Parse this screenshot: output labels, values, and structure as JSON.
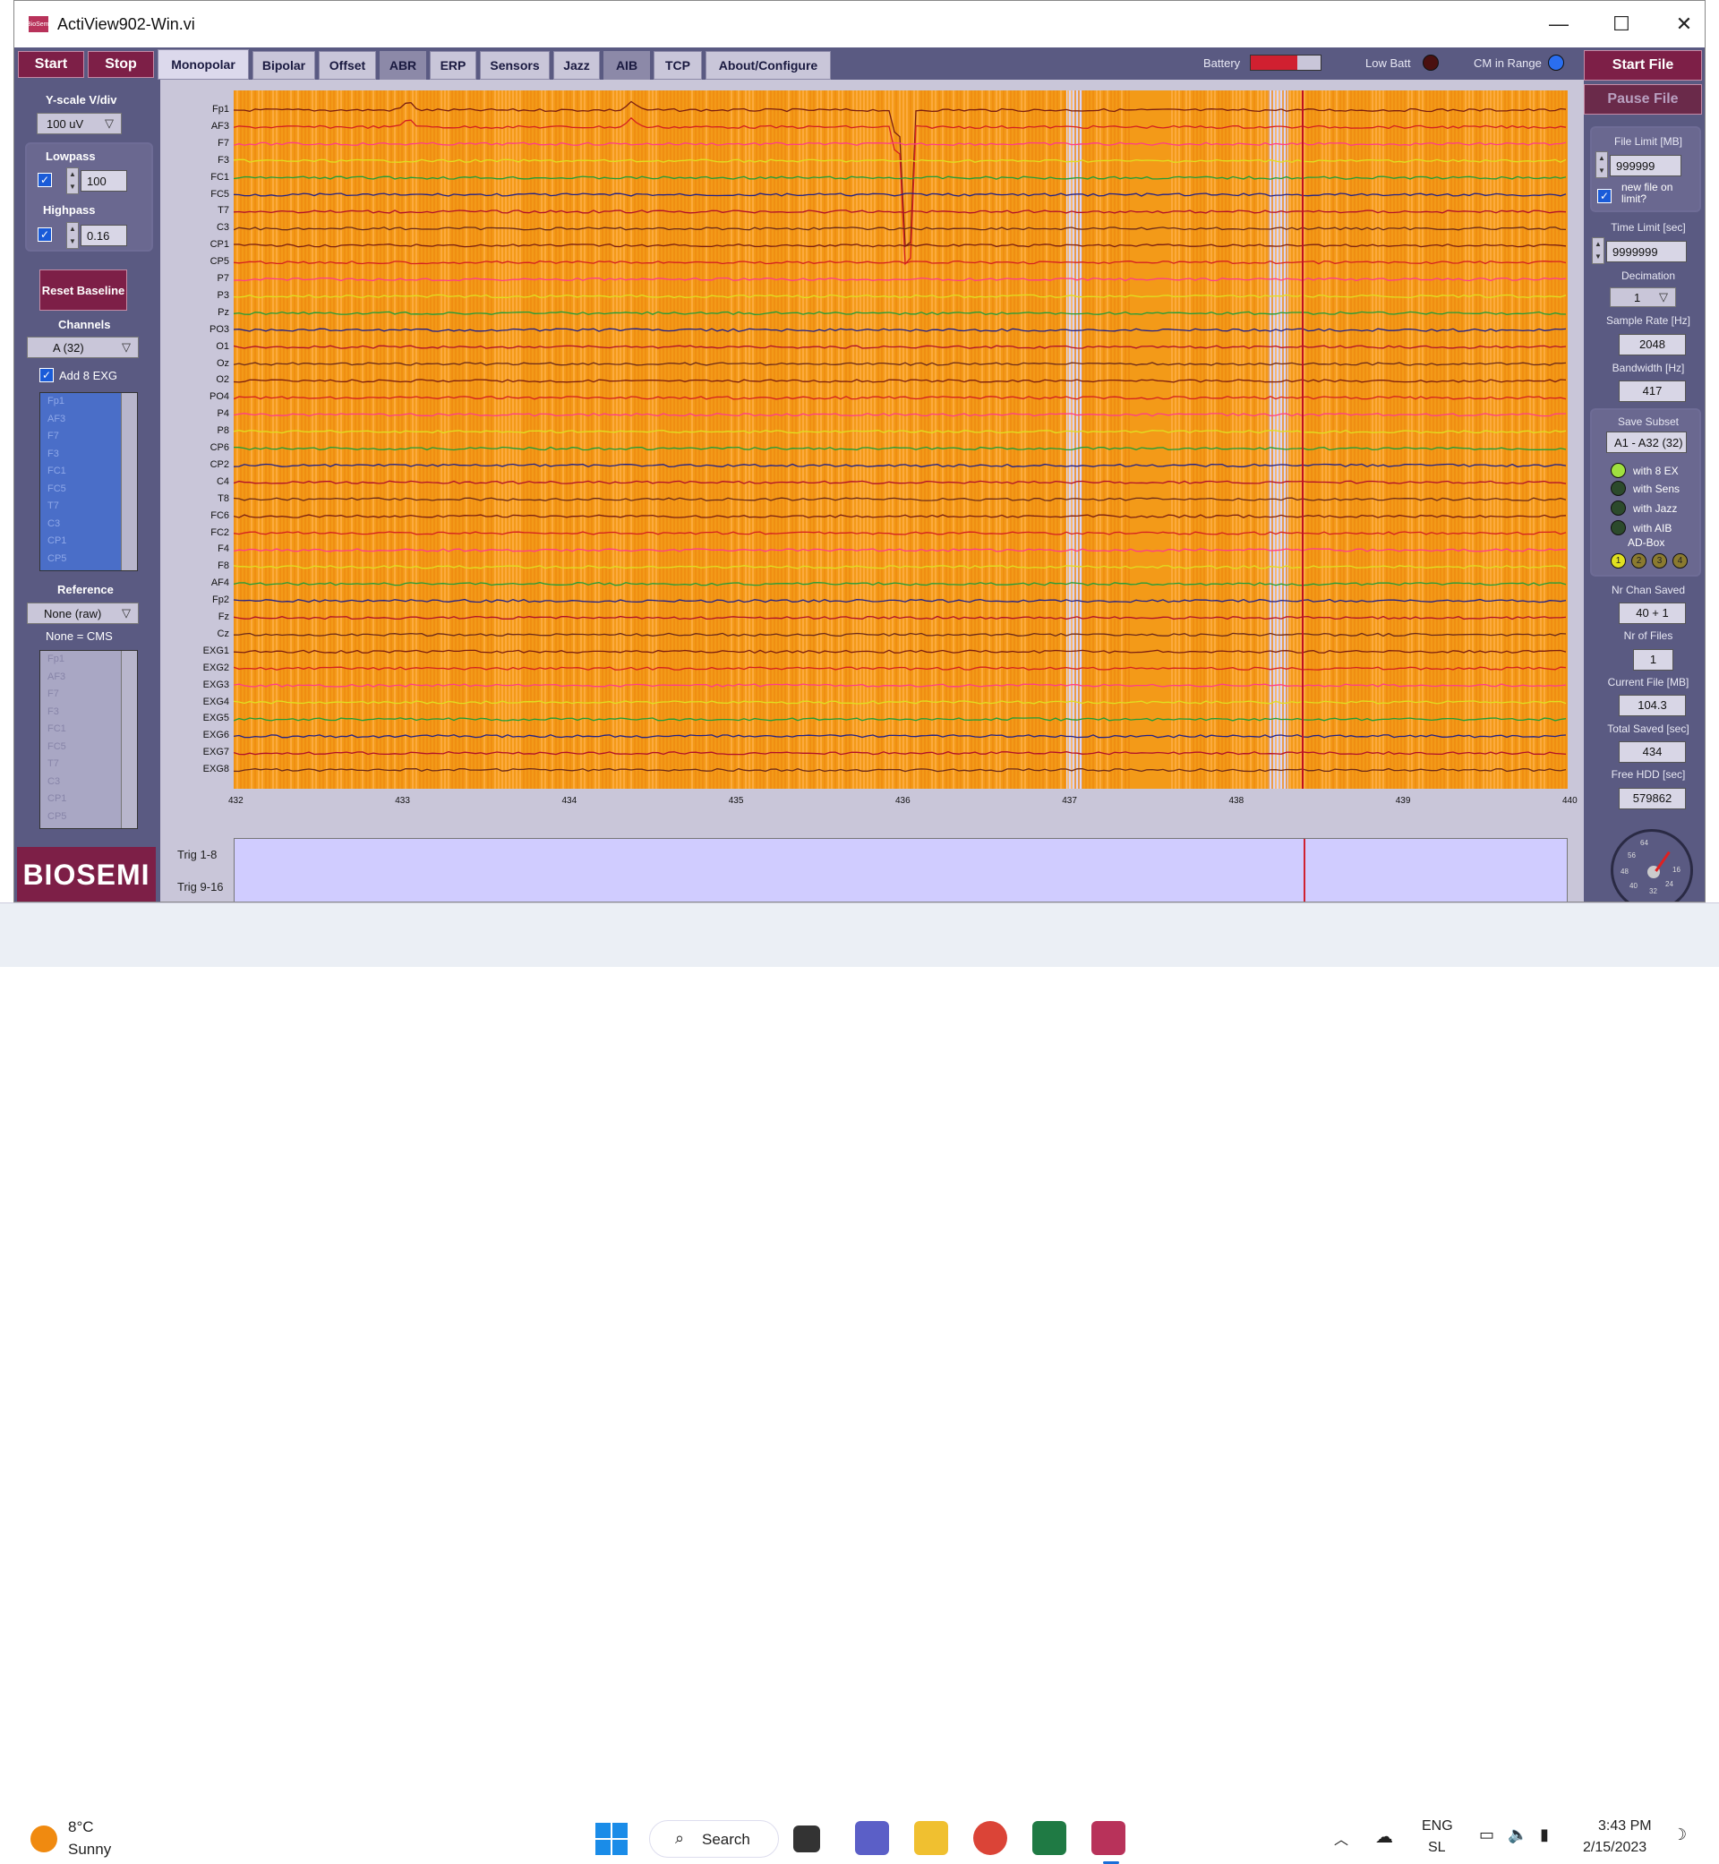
{
  "window": {
    "title": "ActiView902-Win.vi",
    "minimize": "—",
    "maximize": "☐",
    "close": "✕",
    "icon_text": "BioSemi"
  },
  "controls": {
    "start": "Start",
    "stop": "Stop",
    "start_file": "Start File",
    "pause_file": "Pause File"
  },
  "tabs": [
    {
      "label": "Monopolar",
      "active": true
    },
    {
      "label": "Bipolar"
    },
    {
      "label": "Offset"
    },
    {
      "label": "ABR",
      "dim": true
    },
    {
      "label": "ERP"
    },
    {
      "label": "Sensors"
    },
    {
      "label": "Jazz"
    },
    {
      "label": "AIB",
      "dim": true
    },
    {
      "label": "TCP"
    },
    {
      "label": "About/Configure"
    }
  ],
  "indicators": {
    "battery": "Battery",
    "low_batt": "Low Batt",
    "cm_in_range": "CM in Range"
  },
  "left_panel": {
    "yscale_label": "Y-scale V/div",
    "yscale_value": "100 uV",
    "lowpass_label": "Lowpass",
    "lowpass_value": "100",
    "highpass_label": "Highpass",
    "highpass_value": "0.16",
    "reset_baseline": "Reset Baseline",
    "channels_label": "Channels",
    "channels_value": "A (32)",
    "add_exg": "Add 8 EXG",
    "channel_list": [
      "Fp1",
      "AF3",
      "F7",
      "F3",
      "FC1",
      "FC5",
      "T7",
      "C3",
      "CP1",
      "CP5"
    ],
    "reference_label": "Reference",
    "reference_value": "None (raw)",
    "reference_note": "None = CMS",
    "reference_list": [
      "Fp1",
      "AF3",
      "F7",
      "F3",
      "FC1",
      "FC5",
      "T7",
      "C3",
      "CP1",
      "CP5"
    ],
    "checkmark": "✓"
  },
  "plot": {
    "channels": [
      "Fp1",
      "AF3",
      "F7",
      "F3",
      "FC1",
      "FC5",
      "T7",
      "C3",
      "CP1",
      "CP5",
      "P7",
      "P3",
      "Pz",
      "PO3",
      "O1",
      "Oz",
      "O2",
      "PO4",
      "P4",
      "P8",
      "CP6",
      "CP2",
      "C4",
      "T8",
      "FC6",
      "FC2",
      "F4",
      "F8",
      "AF4",
      "Fp2",
      "Fz",
      "Cz",
      "EXG1",
      "EXG2",
      "EXG3",
      "EXG4",
      "EXG5",
      "EXG6",
      "EXG7",
      "EXG8"
    ],
    "x_ticks": [
      "432",
      "433",
      "434",
      "435",
      "436",
      "437",
      "438",
      "439",
      "440"
    ],
    "trace_colors": [
      "#7a1e10",
      "#d42020",
      "#ff3b8a",
      "#e0e020",
      "#1f9e3a",
      "#20208a",
      "#b0102a",
      "#6b2a1a"
    ],
    "background_color": "#f39a18",
    "gap_color": "#d8d4f4"
  },
  "trigger": {
    "trig1": "Trig 1-8",
    "trig2": "Trig 9-16"
  },
  "right_panel": {
    "file_limit_label": "File Limit [MB]",
    "file_limit_value": "999999",
    "new_file_label": "new file on limit?",
    "time_limit_label": "Time Limit [sec]",
    "time_limit_value": "9999999",
    "decimation_label": "Decimation",
    "decimation_value": "1",
    "sample_rate_label": "Sample Rate [Hz]",
    "sample_rate_value": "2048",
    "bandwidth_label": "Bandwidth [Hz]",
    "bandwidth_value": "417",
    "save_subset_label": "Save Subset",
    "save_subset_value": "A1 - A32 (32)",
    "with_8ex": "with 8 EX",
    "with_sens": "with Sens",
    "with_jazz": "with Jazz",
    "with_aib": "with AIB",
    "ad_box": "AD-Box",
    "ad_box_numbers": [
      "1",
      "2",
      "3",
      "4"
    ],
    "nr_chan_saved_label": "Nr Chan Saved",
    "nr_chan_saved_value": "40 + 1",
    "nr_files_label": "Nr of Files",
    "nr_files_value": "1",
    "current_file_label": "Current File [MB]",
    "current_file_value": "104.3",
    "total_saved_label": "Total Saved [sec]",
    "total_saved_value": "434",
    "free_hdd_label": "Free HDD [sec]",
    "free_hdd_value": "579862",
    "gauge_labels": [
      "64",
      "56",
      "48",
      "40",
      "32",
      "24",
      "16"
    ]
  },
  "logo": "BIOSEMI",
  "taskbar": {
    "temperature": "8°C",
    "weather": "Sunny",
    "search": "Search",
    "lang1": "ENG",
    "lang2": "SL",
    "time": "3:43 PM",
    "date": "2/15/2023"
  }
}
